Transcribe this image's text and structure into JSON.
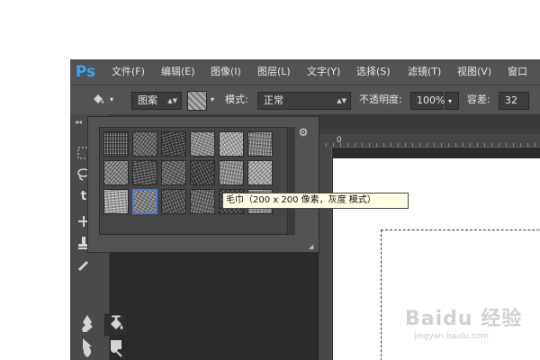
{
  "app": {
    "logo": "Ps"
  },
  "menu": {
    "items": [
      "文件(F)",
      "编辑(E)",
      "图像(I)",
      "图层(L)",
      "文字(Y)",
      "选择(S)",
      "滤镜(T)",
      "视图(V)",
      "窗口"
    ]
  },
  "options": {
    "fill_source": "图案",
    "mode_label": "模式:",
    "mode_value": "正常",
    "opacity_label": "不透明度:",
    "opacity_value": "100%",
    "tolerance_label": "容差:",
    "tolerance_value": "32"
  },
  "ruler": {
    "zero": "0"
  },
  "patterns": {
    "count": 18,
    "selected_index": 13
  },
  "tooltip": {
    "text": "毛巾（200 x 200 像素，灰度 模式）"
  },
  "watermark": {
    "main": "Baidu 经验",
    "sub": "jingyan.baidu.com"
  },
  "colors": {
    "ui_dark": "#535353",
    "canvas_bg": "#2b2b2b",
    "selection_accent": "#4b7bd3",
    "logo_blue": "#31a8ff",
    "tooltip_bg": "#ffffe1"
  }
}
